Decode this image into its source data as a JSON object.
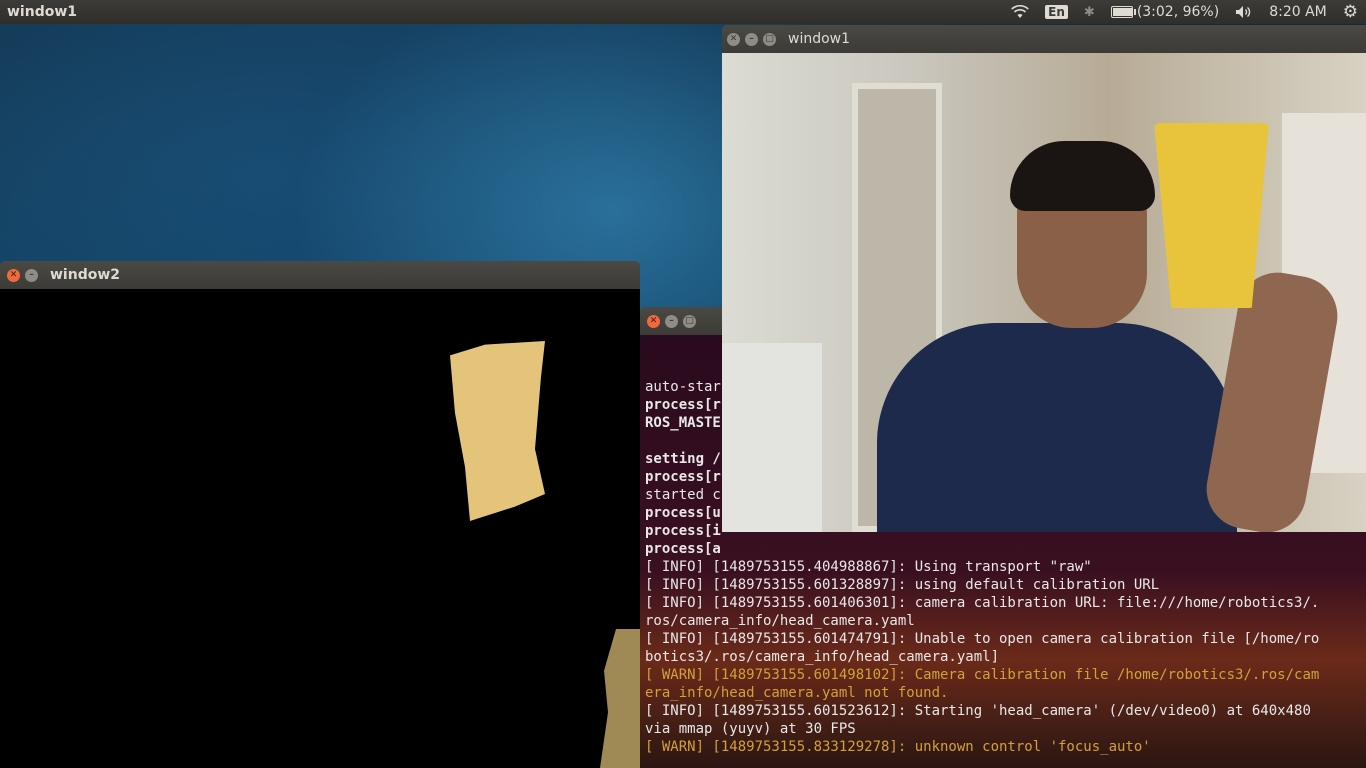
{
  "top_panel": {
    "app_title": "window1",
    "keyboard_layout": "En",
    "battery_text": "(3:02, 96%)",
    "battery_level": 0.96,
    "clock": "8:20 AM"
  },
  "window2": {
    "title": "window2"
  },
  "window1": {
    "title": "window1"
  },
  "terminal": {
    "lines": [
      {
        "text": "auto-star",
        "style": ""
      },
      {
        "text": "process[r",
        "style": "bold"
      },
      {
        "text": "ROS_MASTE",
        "style": "bold"
      },
      {
        "text": "",
        "style": ""
      },
      {
        "text": "setting /",
        "style": "bold"
      },
      {
        "text": "process[r",
        "style": "bold"
      },
      {
        "text": "started c",
        "style": ""
      },
      {
        "text": "process[u",
        "style": "bold"
      },
      {
        "text": "process[i",
        "style": "bold"
      },
      {
        "text": "process[a",
        "style": "bold"
      },
      {
        "text": "[ INFO] [1489753155.404988867]: Using transport \"raw\"",
        "style": ""
      },
      {
        "text": "[ INFO] [1489753155.601328897]: using default calibration URL",
        "style": ""
      },
      {
        "text": "[ INFO] [1489753155.601406301]: camera calibration URL: file:///home/robotics3/.",
        "style": ""
      },
      {
        "text": "ros/camera_info/head_camera.yaml",
        "style": ""
      },
      {
        "text": "[ INFO] [1489753155.601474791]: Unable to open camera calibration file [/home/ro",
        "style": ""
      },
      {
        "text": "botics3/.ros/camera_info/head_camera.yaml]",
        "style": ""
      },
      {
        "text": "[ WARN] [1489753155.601498102]: Camera calibration file /home/robotics3/.ros/cam",
        "style": "warn"
      },
      {
        "text": "era_info/head_camera.yaml not found.",
        "style": "warn"
      },
      {
        "text": "[ INFO] [1489753155.601523612]: Starting 'head_camera' (/dev/video0) at 640x480",
        "style": ""
      },
      {
        "text": "via mmap (yuyv) at 30 FPS",
        "style": ""
      },
      {
        "text": "[ WARN] [1489753155.833129278]: unknown control 'focus_auto'",
        "style": "warn"
      }
    ]
  }
}
